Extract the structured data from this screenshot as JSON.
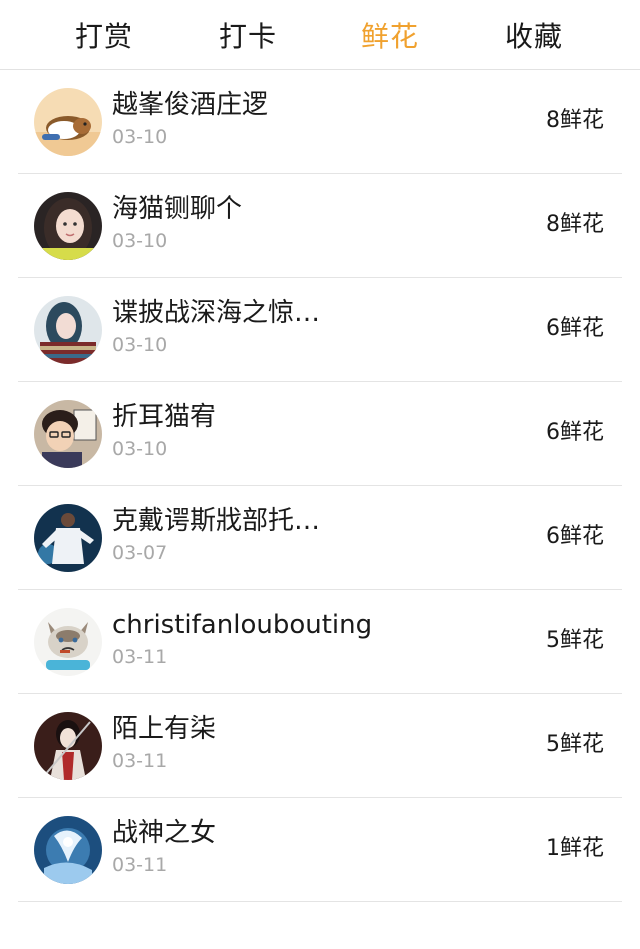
{
  "tabs": [
    {
      "label": "打赏",
      "active": false
    },
    {
      "label": "打卡",
      "active": false
    },
    {
      "label": "鲜花",
      "active": true
    },
    {
      "label": "收藏",
      "active": false
    }
  ],
  "colors": {
    "accent": "#f0a12e",
    "text": "#1a1a1a",
    "muted": "#a8a8a8",
    "divider": "#e4e4e4"
  },
  "list": [
    {
      "name": "越峯俊酒庄逻",
      "date": "03-10",
      "amount": "8鲜花",
      "avatar_icon": "hamster-avatar-icon"
    },
    {
      "name": "海猫铡聊个",
      "date": "03-10",
      "amount": "8鲜花",
      "avatar_icon": "girl-photo-avatar-icon"
    },
    {
      "name": "谍披战深海之惊…",
      "date": "03-10",
      "amount": "6鲜花",
      "avatar_icon": "girl-blue-hair-avatar-icon"
    },
    {
      "name": "折耳猫宥",
      "date": "03-10",
      "amount": "6鲜花",
      "avatar_icon": "anime-boy-avatar-icon"
    },
    {
      "name": "克戴谔斯戕部托…",
      "date": "03-07",
      "amount": "6鲜花",
      "avatar_icon": "white-suit-avatar-icon"
    },
    {
      "name": "christifanloubouting",
      "date": "03-11",
      "amount": "5鲜花",
      "avatar_icon": "grumpy-cat-avatar-icon"
    },
    {
      "name": "陌上有柒",
      "date": "03-11",
      "amount": "5鲜花",
      "avatar_icon": "swordswoman-avatar-icon"
    },
    {
      "name": "战神之女",
      "date": "03-11",
      "amount": "1鲜花",
      "avatar_icon": "ice-warrior-avatar-icon"
    }
  ]
}
